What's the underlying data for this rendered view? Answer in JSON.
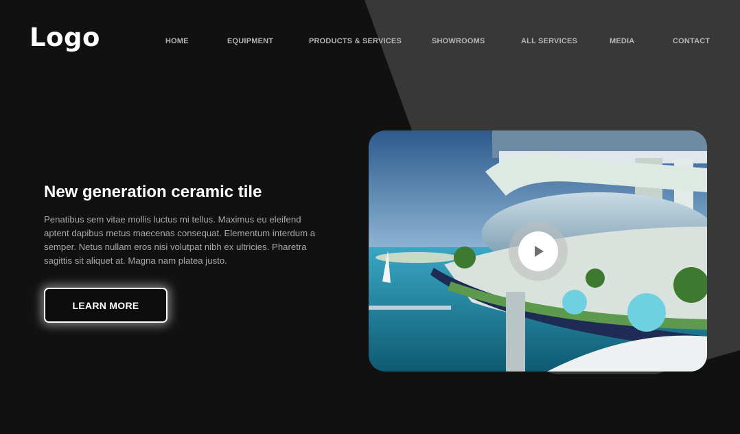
{
  "brand": {
    "logo_text": "Logo"
  },
  "nav": {
    "items": [
      {
        "label": "HOME"
      },
      {
        "label": "EQUIPMENT"
      },
      {
        "label": "PRODUCTS & SERVICES"
      },
      {
        "label": "SHOWROOMS"
      },
      {
        "label": "ALL SERVICES"
      },
      {
        "label": "MEDIA"
      },
      {
        "label": "CONTACT"
      }
    ]
  },
  "hero": {
    "title": "New generation ceramic tile",
    "description": "Penatibus sem vitae mollis luctus mi tellus. Maximus eu eleifend aptent dapibus metus maecenas consequat. Elementum interdum a semper. Netus nullam eros nisi volutpat nibh ex ultricies. Pharetra sagittis sit aliquet at. Magna nam platea justo.",
    "cta_label": "LEARN MORE"
  },
  "video": {
    "icon": "play-icon"
  },
  "colors": {
    "background": "#111111",
    "accent_shape": "#3a3939",
    "text_primary": "#ffffff",
    "text_muted": "#a9a9a9",
    "nav_text": "#b5b5b5"
  }
}
